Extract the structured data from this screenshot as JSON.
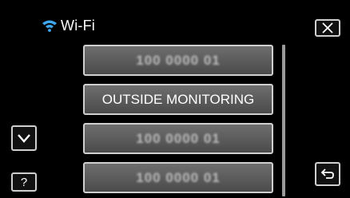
{
  "header": {
    "title": "Wi-Fi",
    "icon": "wifi-icon",
    "icon_color": "#3fa7f0"
  },
  "list": {
    "items": [
      {
        "label": "100 0000 01",
        "obscured": true
      },
      {
        "label": "OUTSIDE MONITORING",
        "obscured": false
      },
      {
        "label": "100 0000 01",
        "obscured": true
      },
      {
        "label": "100 0000 01",
        "obscured": true
      }
    ]
  },
  "buttons": {
    "close_icon": "close-icon",
    "down_icon": "chevron-down-icon",
    "help_label": "?",
    "back_icon": "return-icon"
  }
}
